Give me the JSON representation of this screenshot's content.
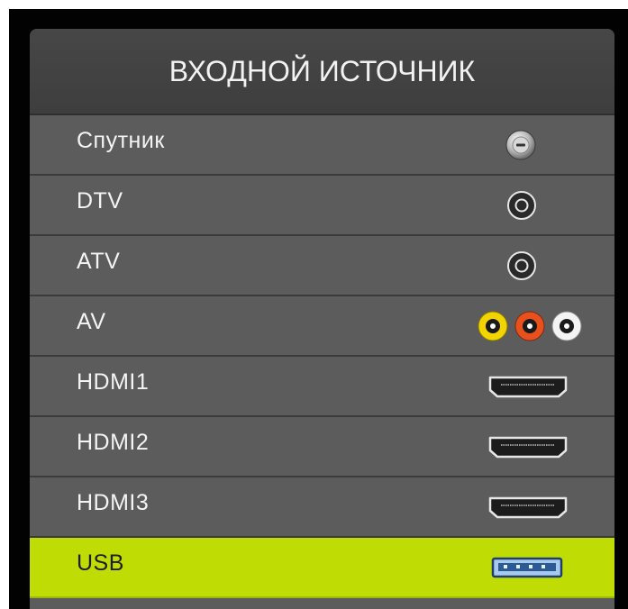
{
  "menu": {
    "title": "ВХОДНОЙ ИСТОЧНИК",
    "items": [
      {
        "label": "Спутник",
        "icon": "satellite-port-icon",
        "selected": false
      },
      {
        "label": "DTV",
        "icon": "antenna-port-icon",
        "selected": false
      },
      {
        "label": "ATV",
        "icon": "antenna-port-icon",
        "selected": false
      },
      {
        "label": "AV",
        "icon": "rca-av-ports-icon",
        "selected": false
      },
      {
        "label": "HDMI1",
        "icon": "hdmi-port-icon",
        "selected": false
      },
      {
        "label": "HDMI2",
        "icon": "hdmi-port-icon",
        "selected": false
      },
      {
        "label": "HDMI3",
        "icon": "hdmi-port-icon",
        "selected": false
      },
      {
        "label": "USB",
        "icon": "usb-port-icon",
        "selected": true
      }
    ]
  },
  "colors": {
    "background": "#020202",
    "panel": "#5c5c5c",
    "header": "#444444",
    "selected_row": "#bfdd05",
    "text": "#f4f4f4",
    "rca_yellow": "#f2d400",
    "rca_red": "#e8501e",
    "rca_white": "#f4f4f4"
  }
}
